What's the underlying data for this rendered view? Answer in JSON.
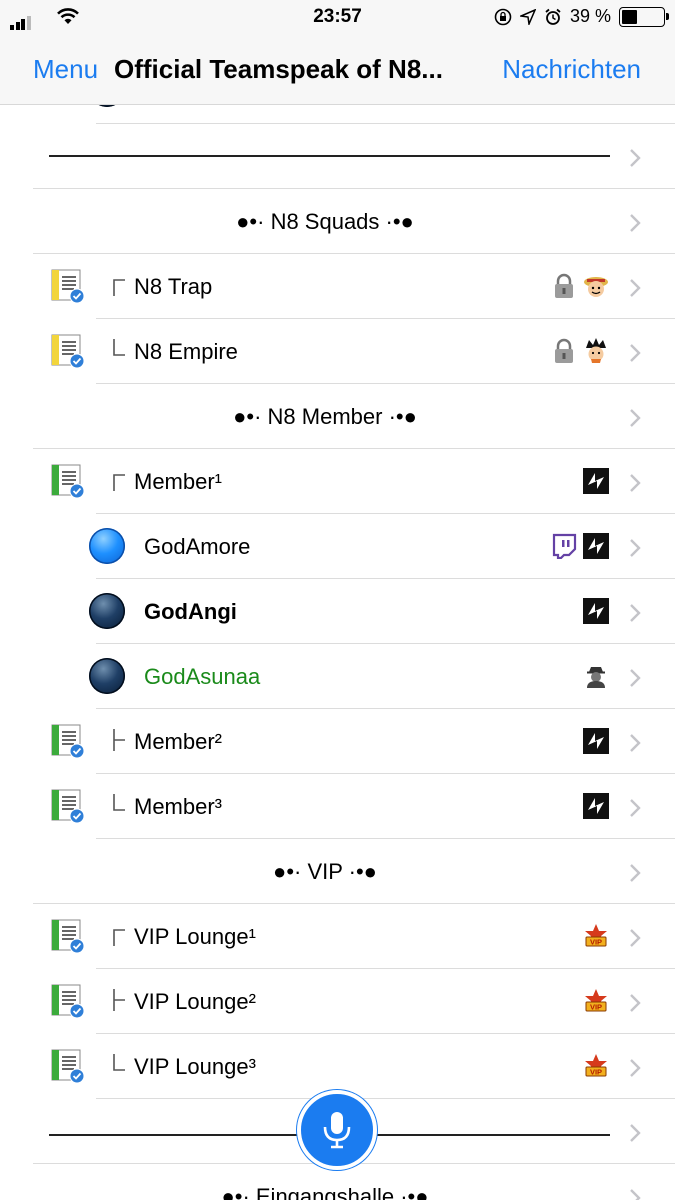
{
  "status_bar": {
    "time": "23:57",
    "battery": "39 %",
    "battery_level": 0.39
  },
  "nav": {
    "left": "Menu",
    "title": "Official Teamspeak of N8...",
    "right": "Nachrichten"
  },
  "rows": {
    "squads_header": "●•· N8 Squads ·•●",
    "n8_trap": "N8 Trap",
    "n8_empire": "N8 Empire",
    "member_header": "●•· N8 Member ·•●",
    "member1": "Member¹",
    "godamore": "GodAmore",
    "godangi": "GodAngi",
    "godasunaa": "GodAsunaa",
    "member2": "Member²",
    "member3": "Member³",
    "vip_header": "●•· VIP ·•●",
    "vip1": "VIP Lounge¹",
    "vip2": "VIP Lounge²",
    "vip3": "VIP Lounge³",
    "entrance_header": "●•· Eingangshalle ·•●"
  },
  "colors": {
    "accent": "#1b7cf0",
    "online_green": "#1a8a1a",
    "twitch": "#6441a5"
  },
  "icons": {
    "channel_yellow": "channel-yellow-icon",
    "channel_green": "channel-green-icon",
    "lock": "lock-icon",
    "n8_group": "n8-group-icon",
    "vip": "vip-icon",
    "twitch": "twitch-icon",
    "away": "away-user-icon"
  }
}
